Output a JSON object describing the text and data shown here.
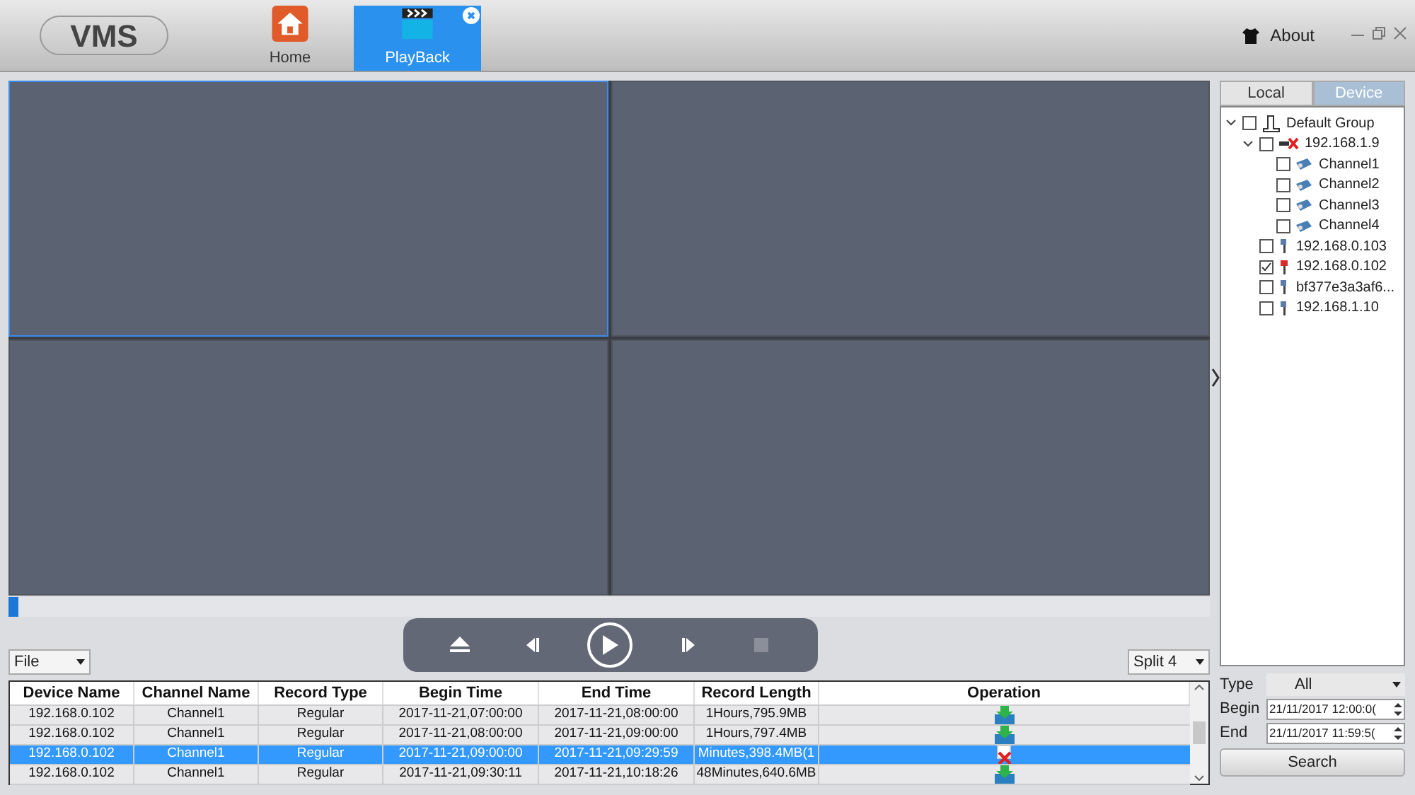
{
  "app": {
    "logo": "VMS",
    "tabs": [
      {
        "label": "Home",
        "kind": "home",
        "selected": false,
        "closable": false
      },
      {
        "label": "PlayBack",
        "kind": "playback",
        "selected": true,
        "closable": true
      }
    ],
    "about": "About"
  },
  "video": {
    "panes": [
      {
        "selected": true
      },
      {
        "selected": false
      },
      {
        "selected": false
      },
      {
        "selected": false
      }
    ],
    "timeline": {
      "level": 0.008
    }
  },
  "controls": {
    "mode": "File",
    "split": "Split 4",
    "buttons": [
      {
        "kind": "eject"
      },
      {
        "kind": "prev"
      },
      {
        "kind": "play"
      },
      {
        "kind": "next"
      },
      {
        "kind": "stop"
      }
    ]
  },
  "table": {
    "columns": [
      "Device Name",
      "Channel Name",
      "Record Type",
      "Begin Time",
      "End Time",
      "Record Length",
      "Operation"
    ],
    "rows": [
      {
        "cells": [
          "192.168.0.102",
          "Channel1",
          "Regular",
          "2017-11-21,07:00:00",
          "2017-11-21,08:00:00",
          "1Hours,795.9MB"
        ],
        "kind": "download",
        "selected": false
      },
      {
        "cells": [
          "192.168.0.102",
          "Channel1",
          "Regular",
          "2017-11-21,08:00:00",
          "2017-11-21,09:00:00",
          "1Hours,797.4MB"
        ],
        "kind": "download",
        "selected": false
      },
      {
        "cells": [
          "192.168.0.102",
          "Channel1",
          "Regular",
          "2017-11-21,09:00:00",
          "2017-11-21,09:29:59",
          "Minutes,398.4MB(1"
        ],
        "kind": "error",
        "selected": true
      },
      {
        "cells": [
          "192.168.0.102",
          "Channel1",
          "Regular",
          "2017-11-21,09:30:11",
          "2017-11-21,10:18:26",
          "48Minutes,640.6MB"
        ],
        "kind": "download",
        "selected": false
      }
    ]
  },
  "sidebar": {
    "tabs": [
      {
        "label": "Local",
        "selected": false
      },
      {
        "label": "Device",
        "selected": true
      }
    ],
    "tree": [
      {
        "label": "Default Group",
        "kind": "group",
        "checked": false,
        "expanded": true,
        "children": [
          {
            "label": "192.168.1.9",
            "kind": "offline",
            "checked": false,
            "expanded": true,
            "children": [
              {
                "label": "Channel1",
                "kind": "camera",
                "checked": false
              },
              {
                "label": "Channel2",
                "kind": "camera",
                "checked": false
              },
              {
                "label": "Channel3",
                "kind": "camera",
                "checked": false
              },
              {
                "label": "Channel4",
                "kind": "camera",
                "checked": false
              }
            ]
          },
          {
            "label": "192.168.0.103",
            "kind": "device",
            "checked": false
          },
          {
            "label": "192.168.0.102",
            "kind": "alarm",
            "checked": true
          },
          {
            "label": "bf377e3a3af6...",
            "kind": "device",
            "checked": false
          },
          {
            "label": "192.168.1.10",
            "kind": "device",
            "checked": false
          }
        ]
      }
    ],
    "filters": {
      "type_label": "Type",
      "type_value": "All",
      "begin_label": "Begin",
      "begin_value": "21/11/2017 12:00:0(",
      "end_label": "End",
      "end_value": "21/11/2017 11:59:5(",
      "search": "Search"
    }
  }
}
